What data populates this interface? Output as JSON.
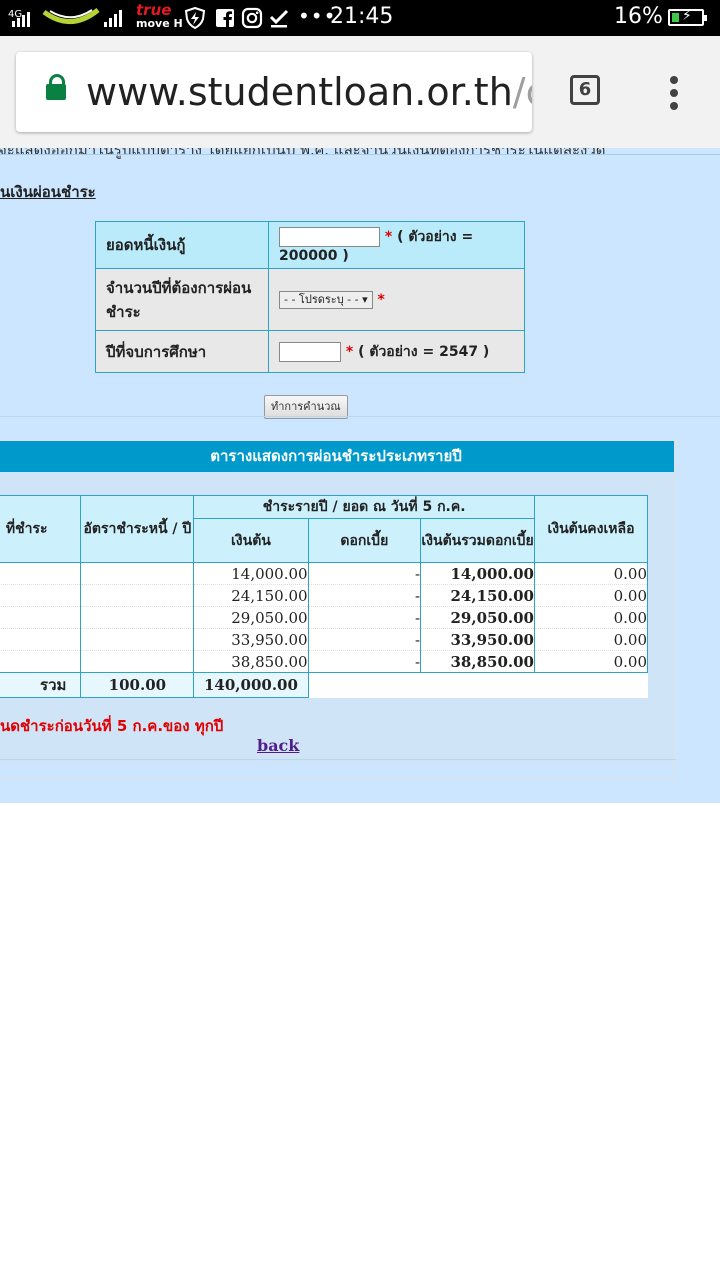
{
  "status_bar": {
    "network": "4G",
    "carrier": "true",
    "carrier_sub": "move H",
    "more": "•••",
    "time": "21:45",
    "battery": "16%",
    "icons": [
      "signal-icon",
      "ais-logo",
      "signal-icon",
      "truemove-logo",
      "shield-bolt-icon",
      "facebook-icon",
      "instagram-icon",
      "check-icon",
      "battery-charging-icon"
    ]
  },
  "browser": {
    "url_host": "www.studentloan.or.th",
    "url_rest": "/c",
    "tab_count": "6",
    "lock_color": "#0b8043"
  },
  "page": {
    "intro_cut": "จะแสดงออกมาในรูปแบบตาราง โดยแยกเป็นปี พ.ศ. และจำนวนเงินที่ต้องการชำระในแต่ละงวด",
    "section_title": "นเงินผ่อนชำระ",
    "form": {
      "debt_label": "ยอดหนี้เงินกู้",
      "debt_hint": "( ตัวอย่าง = 200000 )",
      "years_label": "จำนวนปีที่ต้องการผ่อนชำระ",
      "years_select": "- - โปรดระบุ - -",
      "grad_label": "ปีที่จบการศึกษา",
      "grad_hint": "( ตัวอย่าง = 2547 )",
      "required_mark": "*",
      "calc_button": "ทำการคำนวณ"
    },
    "result": {
      "title": "ตารางแสดงการผ่อนชำระประเภทรายปี",
      "col_year": "ที่ชำระ",
      "col_rate": "อัตราชำระหนี้ / ปี",
      "col_group": "ชำระรายปี / ยอด ณ วันที่ 5 ก.ค.",
      "col_principal": "เงินต้น",
      "col_interest": "ดอกเบี้ย",
      "col_sum": "เงินต้นรวมดอกเบี้ย",
      "col_remaining": "เงินต้นคงเหลือ",
      "rows": [
        {
          "principal": "14,000.00",
          "interest": "-",
          "sum": "14,000.00",
          "remaining": "0.00"
        },
        {
          "principal": "24,150.00",
          "interest": "-",
          "sum": "24,150.00",
          "remaining": "0.00"
        },
        {
          "principal": "29,050.00",
          "interest": "-",
          "sum": "29,050.00",
          "remaining": "0.00"
        },
        {
          "principal": "33,950.00",
          "interest": "-",
          "sum": "33,950.00",
          "remaining": "0.00"
        },
        {
          "principal": "38,850.00",
          "interest": "-",
          "sum": "38,850.00",
          "remaining": "0.00"
        }
      ],
      "total_label": "รวม",
      "total_rate": "100.00",
      "total_principal": "140,000.00"
    },
    "note": "นดชำระก่อนวันที่ 5 ก.ค.ของ ทุกปี",
    "back_link": "back"
  }
}
